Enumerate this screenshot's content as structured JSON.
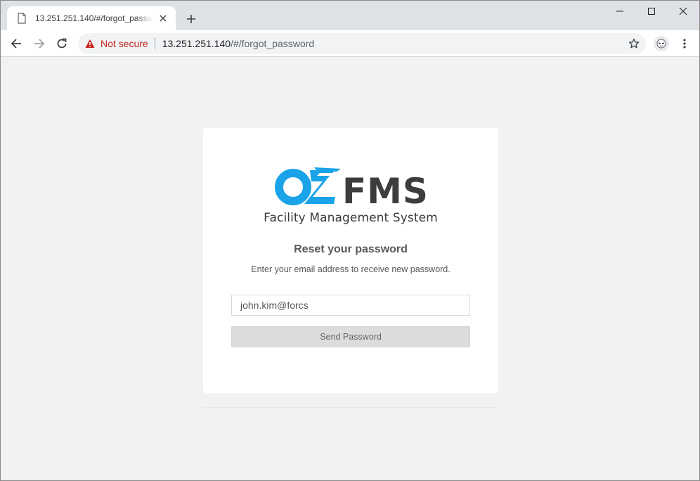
{
  "browser": {
    "tab": {
      "title": "13.251.251.140/#/forgot_password",
      "icon": "page-icon",
      "close_icon": "close-icon"
    },
    "new_tab_icon": "plus-icon",
    "window_controls": [
      "minimize-icon",
      "maximize-icon",
      "close-icon"
    ],
    "toolbar": {
      "back_icon": "back-arrow-icon",
      "forward_icon": "forward-arrow-icon",
      "reload_icon": "reload-icon",
      "security_label": "Not secure",
      "security_icon": "warning-icon",
      "url_host": "13.251.251.140",
      "url_path": "/#/forgot_password",
      "bookmark_icon": "star-icon",
      "profile_icon": "avatar-icon",
      "menu_icon": "kebab-menu-icon"
    }
  },
  "page": {
    "logo": {
      "brand_mark": "OZ",
      "brand_text": "FMS",
      "subtitle": "Facility Management System",
      "colors": {
        "mark": "#1aa3e8",
        "text": "#3d3d3d"
      }
    },
    "title": "Reset your password",
    "description": "Enter your email address to receive new password.",
    "email": {
      "value": "john.kim@forcs",
      "placeholder": ""
    },
    "send_button_label": "Send Password"
  },
  "colors": {
    "page_background": "#f2f2f2",
    "card_background": "#ffffff",
    "not_secure": "#c5221f",
    "button_background": "#dcdcdc"
  }
}
